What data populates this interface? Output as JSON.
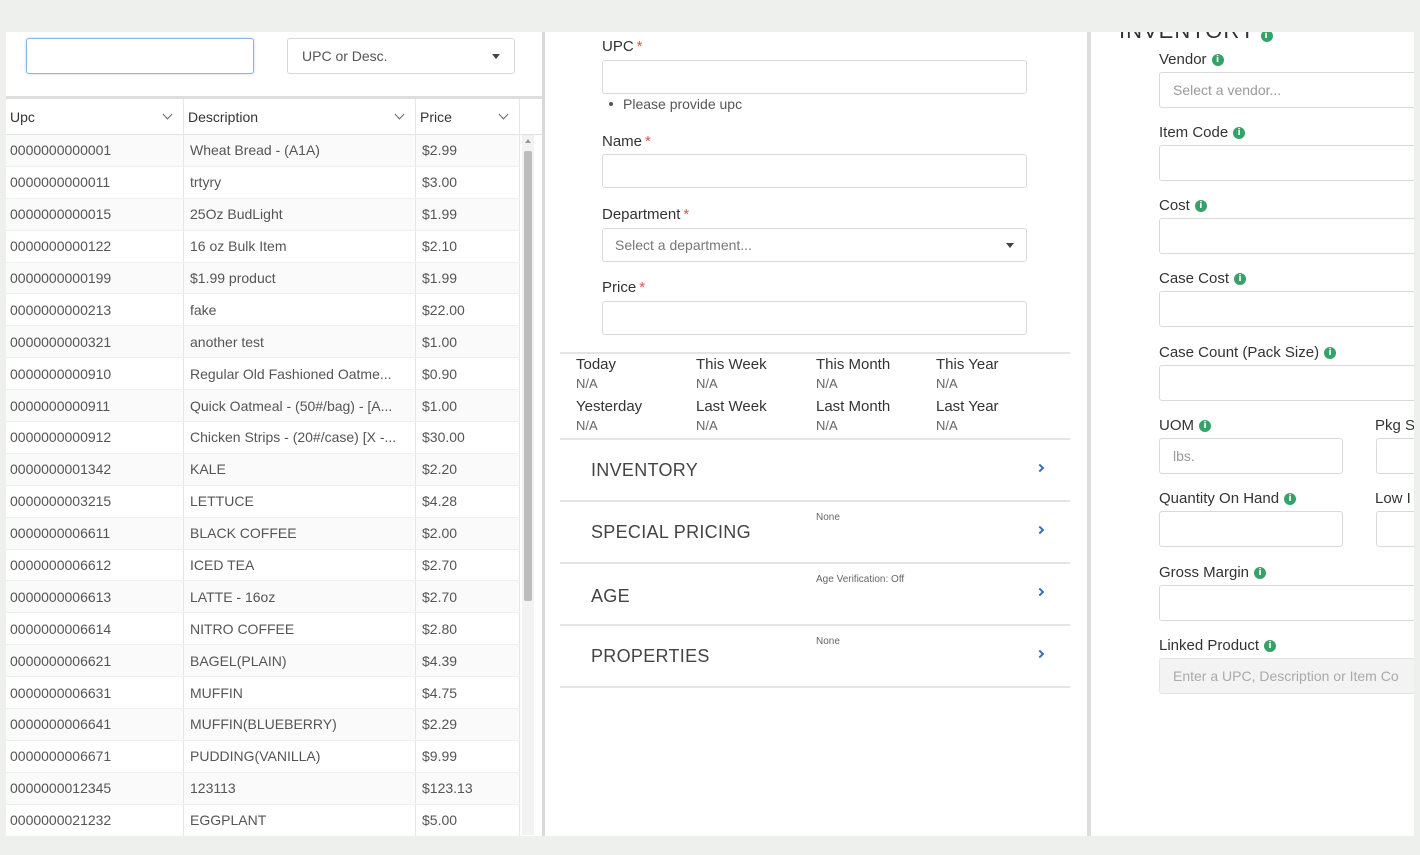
{
  "search": {
    "value": "",
    "filter_label": "UPC or Desc."
  },
  "table": {
    "headers": [
      "Upc",
      "Description",
      "Price"
    ],
    "rows": [
      [
        "0000000000001",
        "Wheat Bread - (A1A)",
        "$2.99"
      ],
      [
        "0000000000011",
        "trtyry",
        "$3.00"
      ],
      [
        "0000000000015",
        "25Oz BudLight",
        "$1.99"
      ],
      [
        "0000000000122",
        "16 oz Bulk Item",
        "$2.10"
      ],
      [
        "0000000000199",
        "$1.99 product",
        "$1.99"
      ],
      [
        "0000000000213",
        "fake",
        "$22.00"
      ],
      [
        "0000000000321",
        "another test",
        "$1.00"
      ],
      [
        "0000000000910",
        "Regular Old Fashioned Oatme...",
        "$0.90"
      ],
      [
        "0000000000911",
        "Quick Oatmeal - (50#/bag) - [A...",
        "$1.00"
      ],
      [
        "0000000000912",
        "Chicken Strips - (20#/case) [X -...",
        "$30.00"
      ],
      [
        "0000000001342",
        "KALE",
        "$2.20"
      ],
      [
        "0000000003215",
        "LETTUCE",
        "$4.28"
      ],
      [
        "0000000006611",
        "BLACK COFFEE",
        "$2.00"
      ],
      [
        "0000000006612",
        "ICED TEA",
        "$2.70"
      ],
      [
        "0000000006613",
        "LATTE - 16oz",
        "$2.70"
      ],
      [
        "0000000006614",
        "NITRO COFFEE",
        "$2.80"
      ],
      [
        "0000000006621",
        "BAGEL(PLAIN)",
        "$4.39"
      ],
      [
        "0000000006631",
        "MUFFIN",
        "$4.75"
      ],
      [
        "0000000006641",
        "MUFFIN(BLUEBERRY)",
        "$2.29"
      ],
      [
        "0000000006671",
        "PUDDING(VANILLA)",
        "$9.99"
      ],
      [
        "0000000012345",
        "123113",
        "$123.13"
      ],
      [
        "0000000021232",
        "EGGPLANT",
        "$5.00"
      ]
    ]
  },
  "form": {
    "upc_label": "UPC",
    "upc_hint": "Please provide upc",
    "name_label": "Name",
    "department_label": "Department",
    "department_placeholder": "Select a department...",
    "price_label": "Price",
    "required_mark": "*"
  },
  "stats": [
    {
      "label": "Today",
      "value": "N/A"
    },
    {
      "label": "This Week",
      "value": "N/A"
    },
    {
      "label": "This Month",
      "value": "N/A"
    },
    {
      "label": "This Year",
      "value": "N/A"
    },
    {
      "label": "Yesterday",
      "value": "N/A"
    },
    {
      "label": "Last Week",
      "value": "N/A"
    },
    {
      "label": "Last Month",
      "value": "N/A"
    },
    {
      "label": "Last Year",
      "value": "N/A"
    }
  ],
  "sections": [
    {
      "title": "INVENTORY",
      "summary": ""
    },
    {
      "title": "SPECIAL PRICING",
      "summary": "None"
    },
    {
      "title": "AGE",
      "summary": "Age Verification: Off"
    },
    {
      "title": "PROPERTIES",
      "summary": "None"
    }
  ],
  "inventory": {
    "heading": "INVENTORY",
    "vendor_label": "Vendor",
    "vendor_placeholder": "Select a vendor...",
    "item_code_label": "Item Code",
    "cost_label": "Cost",
    "case_cost_label": "Case Cost",
    "case_count_label": "Case Count (Pack Size)",
    "uom_label": "UOM",
    "uom_placeholder": "lbs.",
    "pkg_label": "Pkg Si",
    "qoh_label": "Quantity On Hand",
    "low_label": "Low I",
    "gross_margin_label": "Gross Margin",
    "linked_label": "Linked Product",
    "linked_placeholder": "Enter a UPC, Description or Item Co",
    "info_glyph": "i"
  },
  "colors": {
    "accent": "#3a6fb7",
    "info": "#36a269",
    "required": "#d9534f"
  }
}
